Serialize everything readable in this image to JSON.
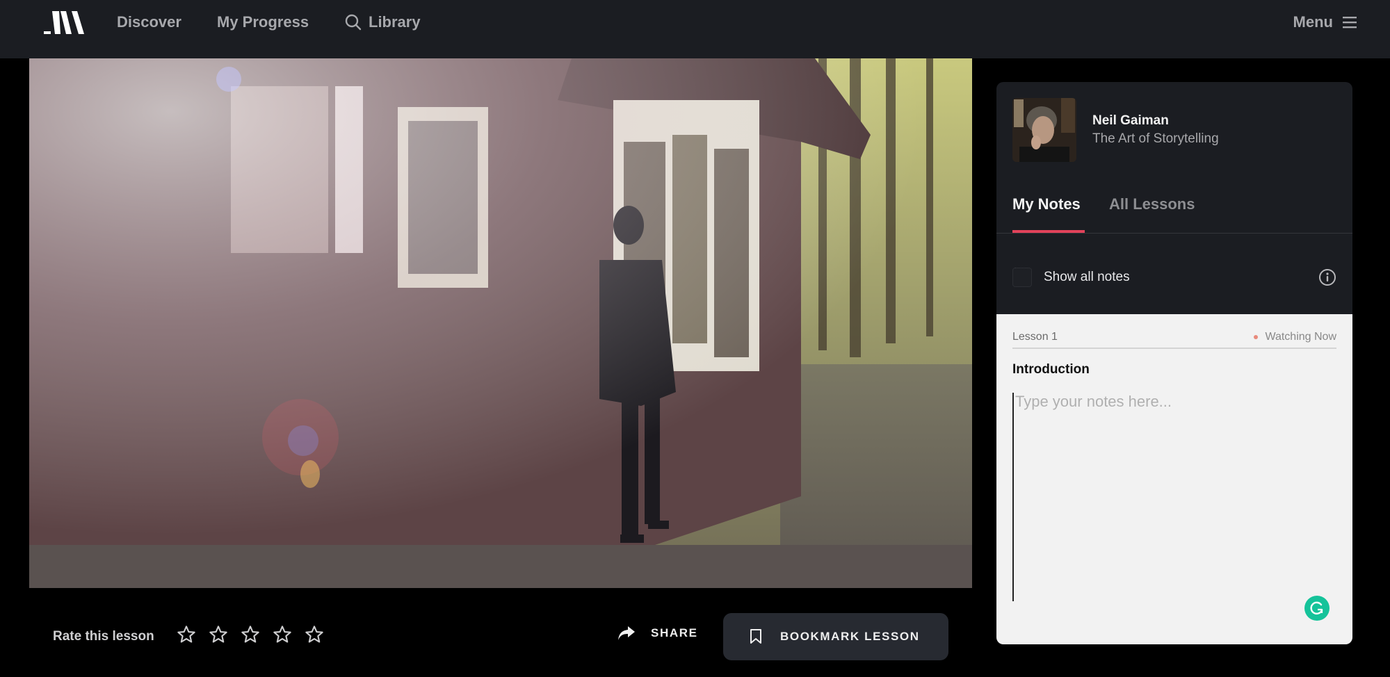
{
  "nav": {
    "logo": "MasterClass logo",
    "items": [
      {
        "label": "Discover",
        "icon": null
      },
      {
        "label": "My Progress",
        "icon": null
      },
      {
        "label": "Library",
        "icon": "search-icon"
      }
    ],
    "menu_label": "Menu",
    "menu_icon": "hamburger-icon"
  },
  "video": {
    "description": "Man in dark clothing walking beside a brown wooden cabin in a sunlit forest"
  },
  "lesson_actions": {
    "rate_label": "Rate this lesson",
    "rating": {
      "value": 0,
      "max": 5
    },
    "share_label": "SHARE",
    "bookmark_label": "BOOKMARK LESSON"
  },
  "sidebar": {
    "author": "Neil Gaiman",
    "course": "The Art of Storytelling",
    "tabs": [
      {
        "label": "My Notes",
        "active": true
      },
      {
        "label": "All Lessons",
        "active": false
      }
    ],
    "show_all_notes": {
      "label": "Show all notes",
      "checked": false
    },
    "notes": {
      "lesson_number": "Lesson 1",
      "status": "Watching Now",
      "lesson_title": "Introduction",
      "placeholder": "Type your notes here...",
      "value": ""
    }
  },
  "colors": {
    "accent": "#e2425a",
    "nav_bg": "#1b1d22",
    "panel_bg": "#1b1d22",
    "notes_bg": "#f2f2f2",
    "grammarly": "#15c39a",
    "watching_dot": "#e88a7c"
  }
}
